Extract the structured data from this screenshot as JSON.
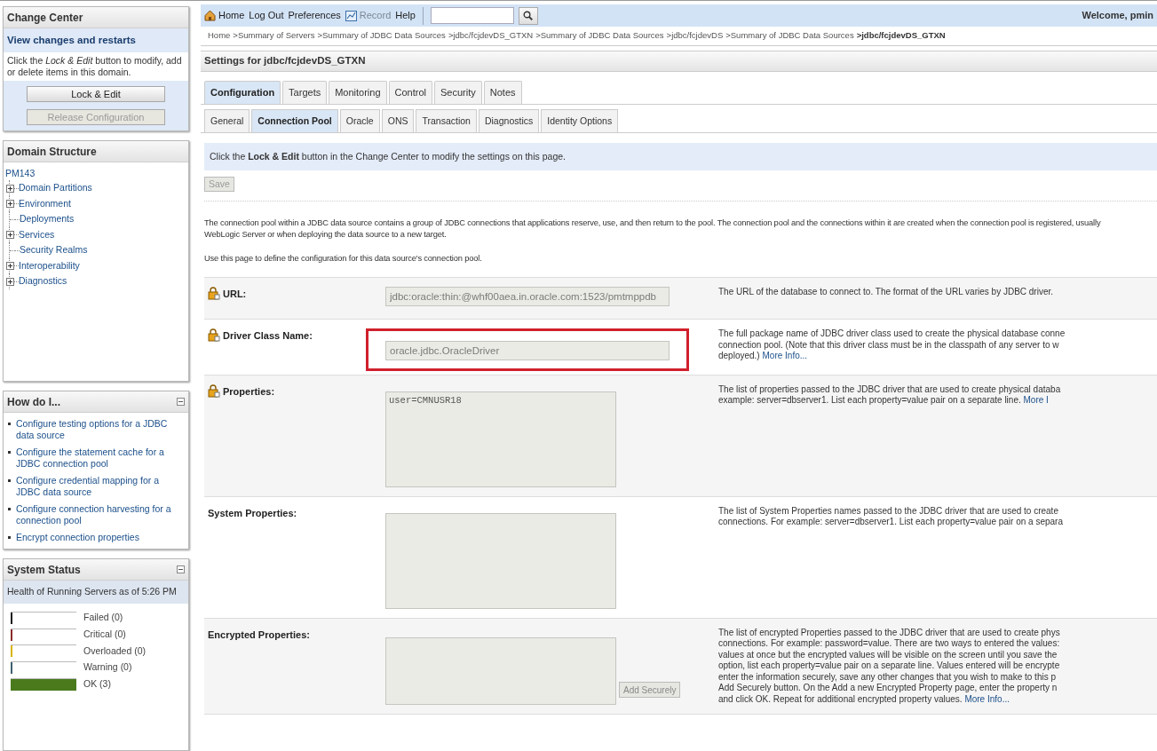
{
  "change_center": {
    "title": "Change Center",
    "subtitle": "View changes and restarts",
    "text": "Click the *Lock & Edit* button to modify, add or delete items in this domain.",
    "buttons": [
      {
        "label": "Lock & Edit",
        "disabled": false
      },
      {
        "label": "Release Configuration",
        "disabled": true
      }
    ]
  },
  "domain_structure": {
    "title": "Domain Structure",
    "tree": {
      "label": "PM143",
      "children": [
        {
          "label": "Domain Partitions",
          "expandable": true
        },
        {
          "label": "Environment",
          "expandable": true
        },
        {
          "label": "Deployments",
          "expandable": false
        },
        {
          "label": "Services",
          "expandable": true
        },
        {
          "label": "Security Realms",
          "expandable": false
        },
        {
          "label": "Interoperability",
          "expandable": true
        },
        {
          "label": "Diagnostics",
          "expandable": true
        }
      ]
    }
  },
  "how_do_i": {
    "title": "How do I...",
    "links": [
      "Configure testing options for a JDBC data source",
      "Configure the statement cache for a JDBC connection pool",
      "Configure credential mapping for a JDBC data source",
      "Configure connection harvesting for a connection pool",
      "Encrypt connection properties"
    ]
  },
  "system_status": {
    "title": "System Status",
    "subtitle": "Health of Running Servers as of  5:26 PM",
    "items": [
      {
        "label": "Failed (0)",
        "color": "#1a1a1a",
        "level": 0
      },
      {
        "label": "Critical (0)",
        "color": "#8b2c2c",
        "level": 0
      },
      {
        "label": "Overloaded (0)",
        "color": "#d8b400",
        "level": 0
      },
      {
        "label": "Warning (0)",
        "color": "#3f5f6f",
        "level": 0
      },
      {
        "label": "OK (3)",
        "color": "#4b7a1d",
        "level": 1
      }
    ]
  },
  "toolbar": {
    "links": [
      {
        "label": "Home",
        "kind": "home",
        "disabled": false
      },
      {
        "label": "Log Out",
        "kind": "plain",
        "disabled": false
      },
      {
        "label": "Preferences",
        "kind": "plain",
        "disabled": false
      },
      {
        "label": "Record",
        "kind": "record",
        "disabled": true
      },
      {
        "label": "Help",
        "kind": "plain",
        "disabled": false
      }
    ],
    "welcome": "Welcome, pmin"
  },
  "breadcrumb": [
    "Home",
    ">Summary of Servers",
    ">Summary of JDBC Data Sources",
    ">jdbc/fcjdevDS_GTXN",
    ">Summary of JDBC Data Sources",
    ">jdbc/fcjdevDS",
    ">Summary of JDBC Data Sources",
    ">jdbc/fcjdevDS_GTXN"
  ],
  "settings_title": "Settings for jdbc/fcjdevDS_GTXN",
  "tabs": [
    {
      "label": "Configuration",
      "selected": true
    },
    {
      "label": "Targets",
      "selected": false
    },
    {
      "label": "Monitoring",
      "selected": false
    },
    {
      "label": "Control",
      "selected": false
    },
    {
      "label": "Security",
      "selected": false
    },
    {
      "label": "Notes",
      "selected": false
    }
  ],
  "subtabs": [
    {
      "label": "General",
      "selected": false
    },
    {
      "label": "Connection Pool",
      "selected": true
    },
    {
      "label": "Oracle",
      "selected": false
    },
    {
      "label": "ONS",
      "selected": false
    },
    {
      "label": "Transaction",
      "selected": false
    },
    {
      "label": "Diagnostics",
      "selected": false
    },
    {
      "label": "Identity Options",
      "selected": false
    }
  ],
  "notice": "Click the **Lock & Edit** button in the Change Center to modify the settings on this page.",
  "save_button": {
    "label": "Save",
    "disabled": true
  },
  "intro": [
    [
      "The connection pool within a JDBC data source contains a group of JDBC connections that applications reserve, use, and then return to the pool. The connection pool and the connections within it are created when the connection pool is registered, usually",
      "WebLogic Server or when deploying the data source to a new target."
    ],
    [
      "Use this page to define the configuration for this data source's connection pool."
    ]
  ],
  "fields": [
    {
      "kind": "input",
      "label": "URL:",
      "has_icon": true,
      "value": "jdbc:oracle:thin:@whf00aea.in.oracle.com:1523/pmtmppdb",
      "highlighted": false,
      "description": [
        "The URL of the database to connect to. The format of the URL varies by JDBC driver."
      ]
    },
    {
      "kind": "input",
      "label": "Driver Class Name:",
      "has_icon": true,
      "value": "oracle.jdbc.OracleDriver",
      "highlighted": true,
      "description": [
        "The full package name of JDBC driver class used to create the physical database conne",
        "connection pool. (Note that this driver class must be in the classpath of any server to w",
        "deployed.)"
      ],
      "link": "More Info..."
    },
    {
      "kind": "textarea",
      "label": "Properties:",
      "has_icon": true,
      "value": "user=CMNUSR18",
      "description": [
        "The list of properties passed to the JDBC driver that are used to create physical databa",
        "example: server=dbserver1. List each property=value pair on a separate line."
      ],
      "link": "More I"
    },
    {
      "kind": "textarea",
      "label": "System Properties:",
      "has_icon": false,
      "description": [
        "The list of System Properties names passed to the JDBC driver that are used to create",
        "connections. For example: server=dbserver1. List each property=value pair on a separa"
      ]
    },
    {
      "kind": "textarea_button",
      "label": "Encrypted Properties:",
      "has_icon": false,
      "button": "Add Securely",
      "description": [
        "The list of encrypted Properties passed to the JDBC driver that are used to create phys",
        "connections. For example: password=value. There are two ways to entered the values:",
        "values at once but the encrypted values will be visible on the screen until you save the",
        "option, list each property=value pair on a separate line. Values entered will be encrypte",
        "enter the information securely, save any other changes that you wish to make to this p",
        "Add Securely button. On the Add a new Encrypted Property page, enter the property n",
        "and click OK. Repeat for additional encrypted property values."
      ],
      "link": "More Info..."
    }
  ]
}
